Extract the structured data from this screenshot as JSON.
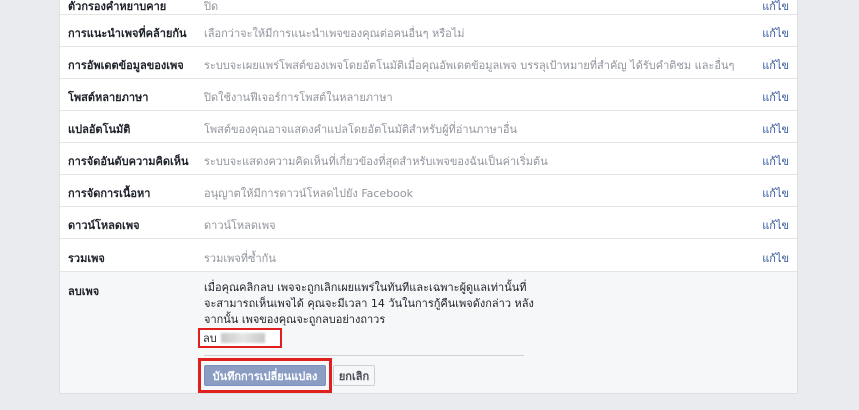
{
  "settings": {
    "edit_label": "แก้ไข",
    "rows": [
      {
        "label": "ตัวกรองคำหยาบคาย",
        "desc": "ปิด"
      },
      {
        "label": "การแนะนำเพจที่คล้ายกัน",
        "desc": "เลือกว่าจะให้มีการแนะนำเพจของคุณต่อคนอื่นๆ หรือไม่"
      },
      {
        "label": "การอัพเดตข้อมูลของเพจ",
        "desc": "ระบบจะเผยแพร่โพสต์ของเพจโดยอัตโนมัติเมื่อคุณอัพเดตข้อมูลเพจ บรรลุเป้าหมายที่สำคัญ ได้รับคำติชม และอื่นๆ"
      },
      {
        "label": "โพสต์หลายภาษา",
        "desc": "ปิดใช้งานฟีเจอร์การโพสต์ในหลายภาษา"
      },
      {
        "label": "แปลอัตโนมัติ",
        "desc": "โพสต์ของคุณอาจแสดงคำแปลโดยอัตโนมัติสำหรับผู้ที่อ่านภาษาอื่น"
      },
      {
        "label": "การจัดอันดับความคิดเห็น",
        "desc": "ระบบจะแสดงความคิดเห็นที่เกี่ยวข้องที่สุดสำหรับเพจของฉันเป็นค่าเริ่มต้น"
      },
      {
        "label": "การจัดการเนื้อหา",
        "desc": "อนุญาตให้มีการดาวน์โหลดไปยัง Facebook"
      },
      {
        "label": "ดาวน์โหลดเพจ",
        "desc": "ดาวน์โหลดเพจ"
      },
      {
        "label": "รวมเพจ",
        "desc": "รวมเพจที่ซ้ำกัน"
      }
    ]
  },
  "remove_page": {
    "label": "ลบเพจ",
    "text_lines": [
      "เมื่อคุณคลิกลบ เพจจะถูกเลิกเผยแพร่ในทันทีและเฉพาะผู้ดูแลเท่านั้นที่",
      "จะสามารถเห็นเพจได้ คุณจะมีเวลา 14 วันในการกู้คืนเพจดังกล่าว หลัง",
      "จากนั้น เพจของคุณจะถูกลบอย่างถาวร"
    ],
    "delete_link_prefix": "ลบ",
    "save_button": "บันทึกการเปลี่ยนแปลง",
    "cancel_button": "ยกเลิก"
  },
  "colors": {
    "accent": "#365899",
    "highlight": "#e0201e",
    "save_button": "#8b9dc3"
  }
}
